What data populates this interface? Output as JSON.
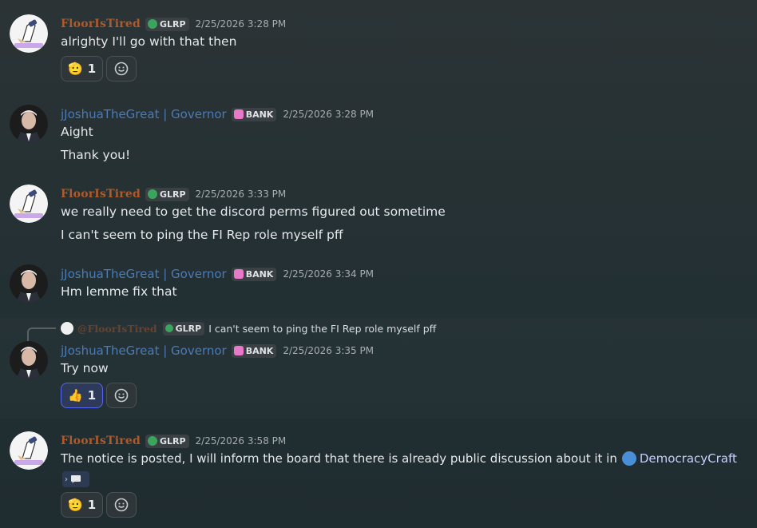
{
  "messages": [
    {
      "author": "FloorIsTired",
      "tag": "GLRP",
      "time": "2/25/2026 3:28 PM",
      "lines": [
        "alrighty I'll go with that then"
      ],
      "reactions": [
        {
          "emoji": "🫡",
          "count": "1"
        }
      ]
    },
    {
      "author": "jJoshuaTheGreat | Governor",
      "tag": "BANK",
      "time": "2/25/2026 3:28 PM",
      "lines": [
        "Aight",
        "Thank you!"
      ]
    },
    {
      "author": "FloorIsTired",
      "tag": "GLRP",
      "time": "2/25/2026 3:33 PM",
      "lines": [
        "we really need to get the discord perms figured out sometime",
        "I can't seem to ping the FI Rep role myself pff"
      ]
    },
    {
      "author": "jJoshuaTheGreat | Governor",
      "tag": "BANK",
      "time": "2/25/2026 3:34 PM",
      "lines": [
        "Hm lemme fix that"
      ]
    },
    {
      "reply_to": {
        "author": "@FloorIsTired",
        "tag": "GLRP",
        "text": "I can't seem to ping the FI Rep role myself pff"
      },
      "author": "jJoshuaTheGreat | Governor",
      "tag": "BANK",
      "time": "2/25/2026 3:35 PM",
      "lines": [
        "Try now"
      ],
      "reactions": [
        {
          "emoji": "👍",
          "count": "1"
        }
      ]
    },
    {
      "author": "FloorIsTired",
      "tag": "GLRP",
      "time": "2/25/2026 3:58 PM",
      "lines": [
        "The notice is posted, I will inform the board that there is already public discussion about it in"
      ],
      "channel_mention": "DemocracyCraft",
      "reactions": [
        {
          "emoji": "🫡",
          "count": "1"
        }
      ]
    }
  ],
  "colors": {
    "floor_name": "#b05a2a",
    "josh_name": "#4a7bb5",
    "glrp_icon": "#3ba55d",
    "bank_icon": "#e879c9",
    "mention": "#c9cdfb"
  },
  "icons": {
    "add_reaction": "smile-plus-icon",
    "thread": "speech-bubble-icon",
    "channel": "server-icon"
  }
}
